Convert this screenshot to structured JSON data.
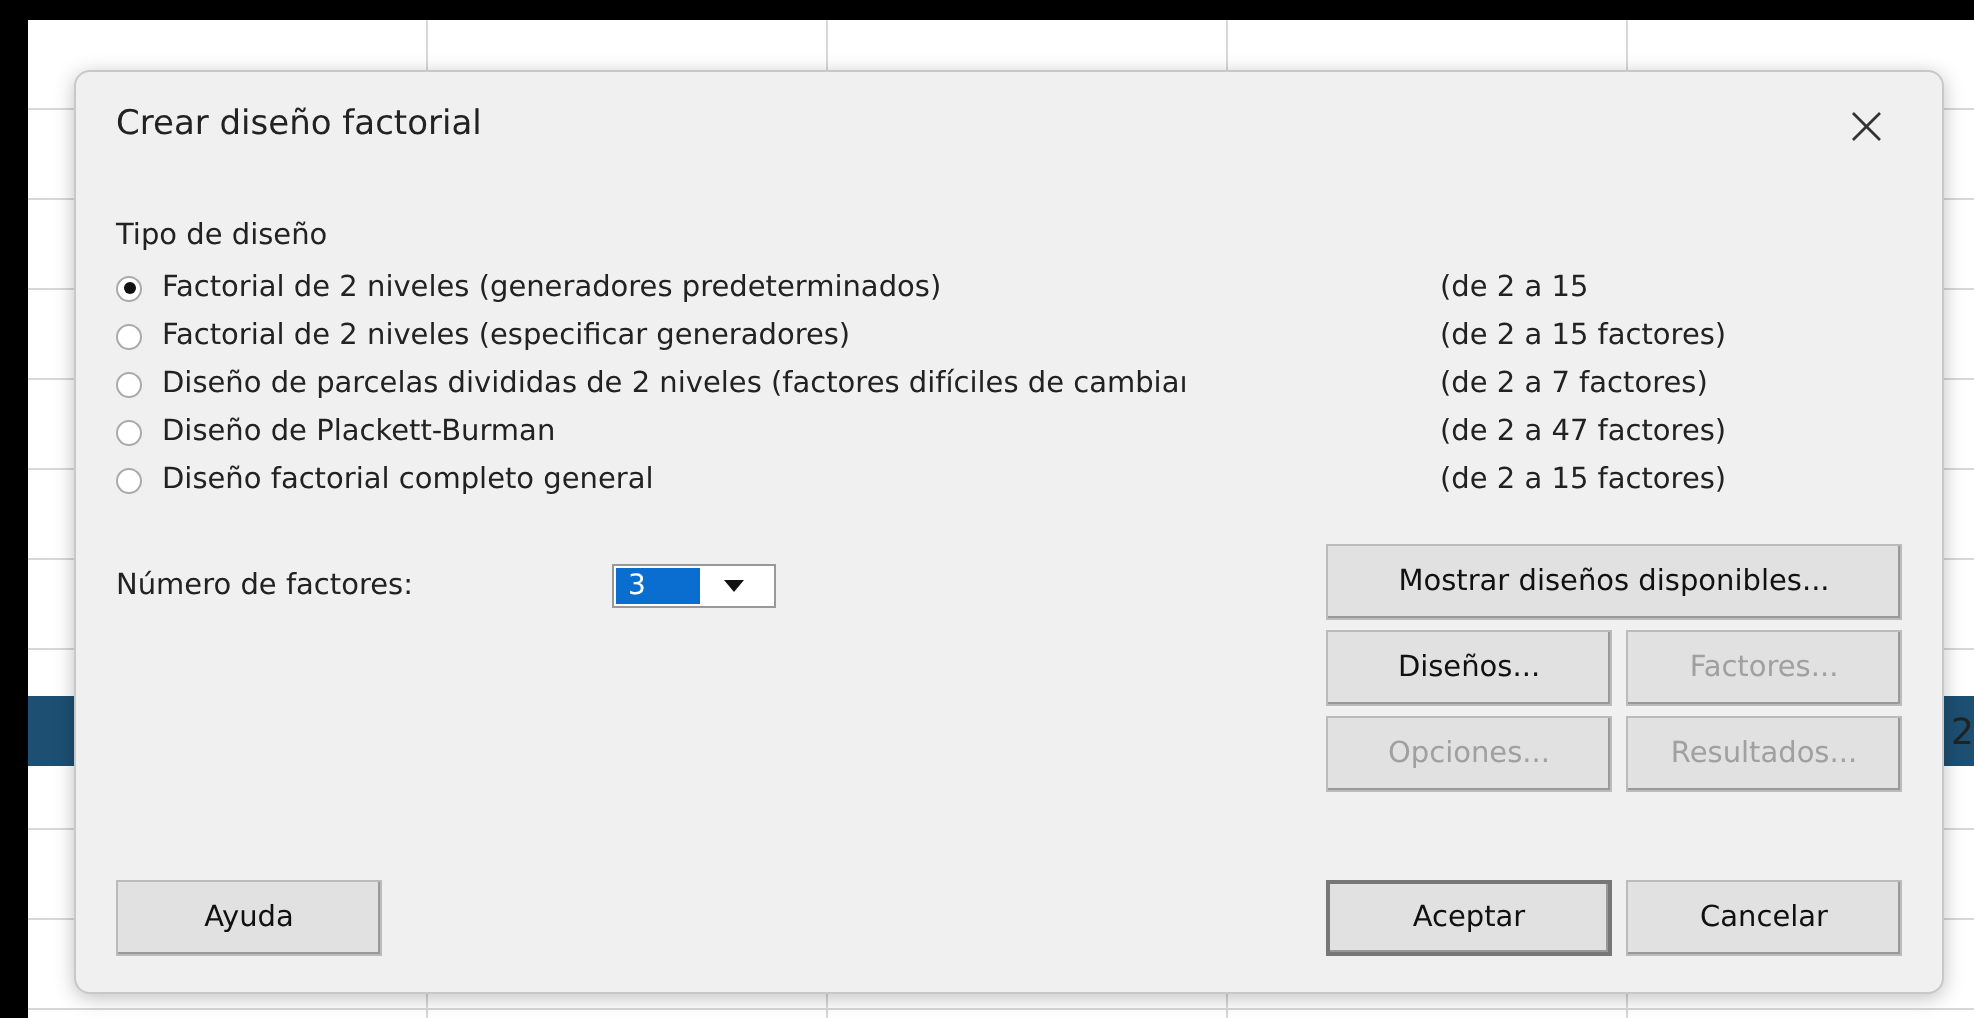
{
  "window": {
    "title": "Crear diseño factorial",
    "close": "×"
  },
  "design_type": {
    "label": "Tipo de diseño",
    "options": [
      {
        "label": "Factorial de 2 niveles (generadores predeterminados)",
        "range": "(de 2 a 15",
        "selected": true
      },
      {
        "label": "Factorial de 2 niveles (especificar generadores)",
        "range": "(de 2 a 15 factores)",
        "selected": false
      },
      {
        "label": "Diseño de parcelas divididas de 2 niveles (factores difíciles de cambiaı",
        "range": "(de 2 a 7 factores)",
        "selected": false
      },
      {
        "label": "Diseño de Plackett-Burman",
        "range": "(de 2 a 47 factores)",
        "selected": false
      },
      {
        "label": "Diseño factorial completo general",
        "range": "(de 2 a 15 factores)",
        "selected": false
      }
    ]
  },
  "factors": {
    "label": "Número de factores:",
    "value": "3"
  },
  "buttons": [
    {
      "label": "Mostrar diseños disponibles...",
      "disabled": false,
      "default": false
    },
    {
      "label": "Diseños...",
      "disabled": false,
      "default": false
    },
    {
      "label": "Factores...",
      "disabled": true,
      "default": false
    },
    {
      "label": "Opciones...",
      "disabled": true,
      "default": false
    },
    {
      "label": "Resultados...",
      "disabled": true,
      "default": false
    }
  ],
  "footer": {
    "help": "Ayuda",
    "ok": {
      "label": "Aceptar",
      "default": true
    },
    "cancel": "Cancelar"
  },
  "background_sheet": {
    "cell_text": "2"
  }
}
